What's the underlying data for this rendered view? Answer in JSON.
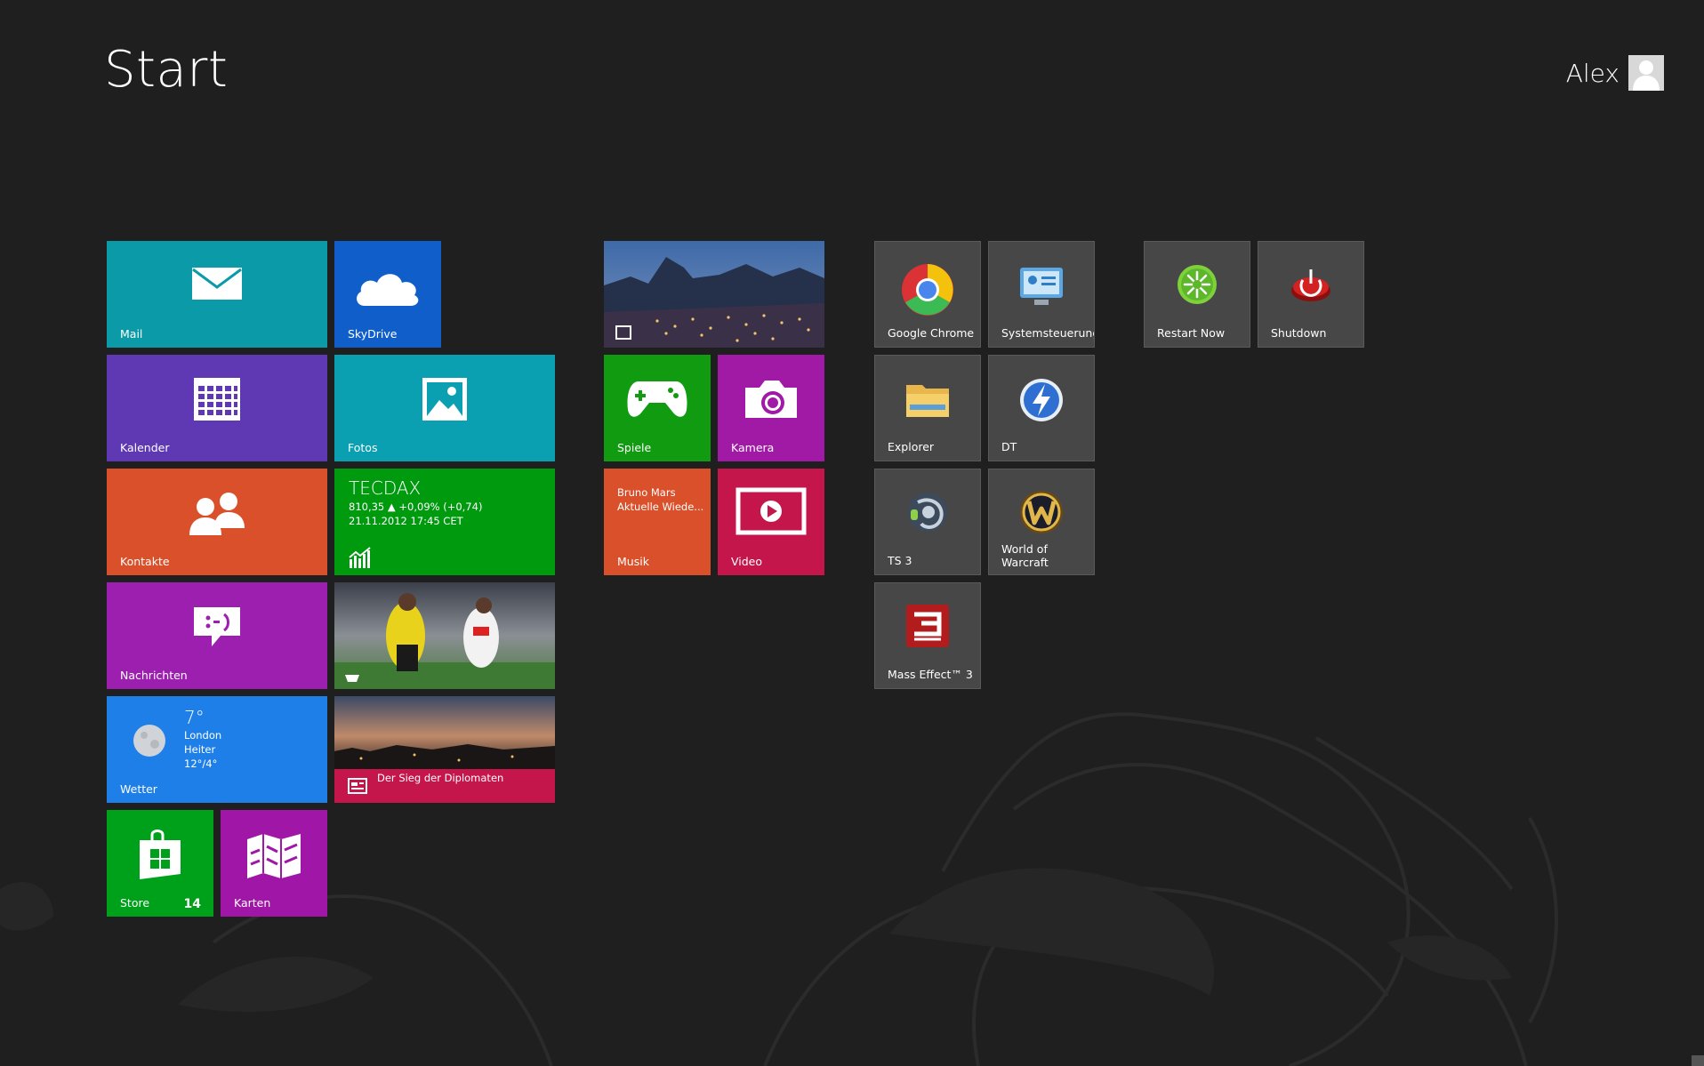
{
  "header": {
    "title": "Start",
    "user_name": "Alex"
  },
  "tiles": {
    "mail": {
      "label": "Mail",
      "color": "#0b9aa8"
    },
    "skydrive": {
      "label": "SkyDrive",
      "color": "#0f5ec9"
    },
    "kalender": {
      "label": "Kalender",
      "color": "#5f38b3"
    },
    "fotos": {
      "label": "Fotos",
      "color": "#0aa0b2"
    },
    "kontakte": {
      "label": "Kontakte",
      "color": "#d9502a"
    },
    "finance": {
      "title": "TECDAX",
      "line1": "810,35 ▲ +0,09% (+0,74)",
      "line2": "21.11.2012 17:45 CET",
      "color": "#009a0f"
    },
    "nachrichten": {
      "label": "Nachrichten",
      "color": "#9d1fb0"
    },
    "wetter": {
      "label": "Wetter",
      "temp": "7°",
      "city": "London",
      "condition": "Heiter",
      "range": "12°/4°",
      "color": "#1e7fe8"
    },
    "news": {
      "headline": "Der Sieg der Diplomaten",
      "color": "#c4164b"
    },
    "store": {
      "label": "Store",
      "badge": "14",
      "color": "#00a11a"
    },
    "karten": {
      "label": "Karten",
      "color": "#a017a8"
    },
    "spiele": {
      "label": "Spiele",
      "color": "#119b11"
    },
    "kamera": {
      "label": "Kamera",
      "color": "#a01aa6"
    },
    "musik": {
      "label": "Musik",
      "line1": "Bruno Mars",
      "line2": "Aktuelle Wiede...",
      "color": "#d9502a"
    },
    "video": {
      "label": "Video",
      "color": "#c4164b"
    },
    "chrome": {
      "label": "Google Chrome"
    },
    "systemsteuerung": {
      "label": "Systemsteuerung"
    },
    "explorer": {
      "label": "Explorer"
    },
    "dt": {
      "label": "DT"
    },
    "ts3": {
      "label": "TS 3"
    },
    "wow": {
      "label_line1": "World of",
      "label_line2": "Warcraft"
    },
    "masseffect": {
      "label": "Mass Effect™ 3"
    },
    "restart": {
      "label": "Restart Now"
    },
    "shutdown": {
      "label": "Shutdown"
    }
  }
}
